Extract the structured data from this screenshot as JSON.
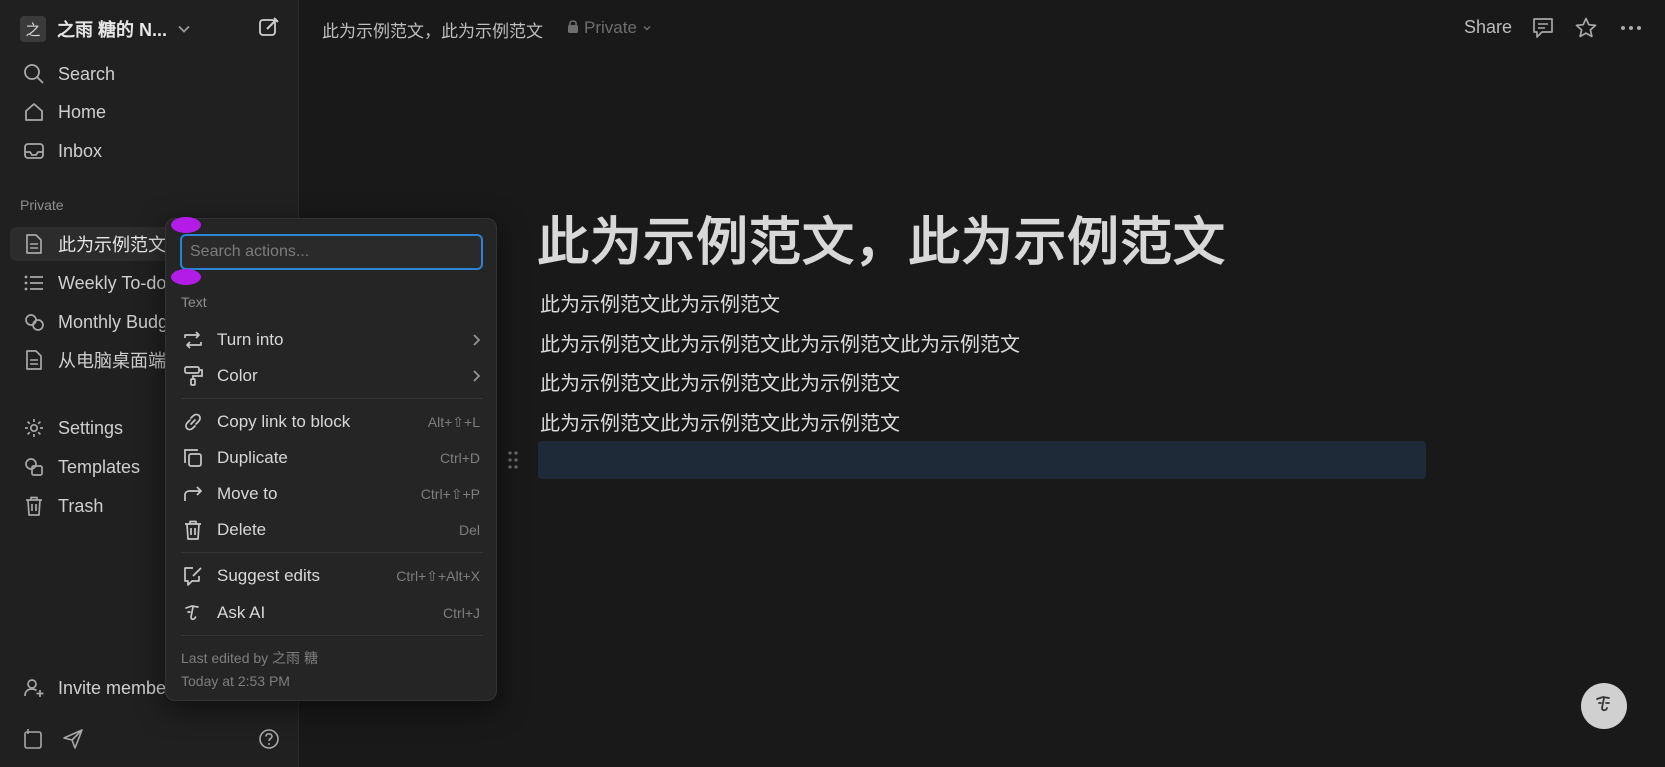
{
  "sidebar": {
    "workspace": {
      "avatar": "之",
      "name": "之雨 糖的 N..."
    },
    "nav": [
      {
        "label": "Search",
        "icon": "search-icon"
      },
      {
        "label": "Home",
        "icon": "home-icon"
      },
      {
        "label": "Inbox",
        "icon": "inbox-icon"
      }
    ],
    "section_label": "Private",
    "pages": [
      {
        "label": "此为示例范文",
        "icon": "page-icon"
      },
      {
        "label": "Weekly To-do",
        "icon": "list-icon"
      },
      {
        "label": "Monthly Budg",
        "icon": "budget-icon"
      },
      {
        "label": "从电脑桌面端",
        "icon": "page-icon"
      }
    ],
    "utility": [
      {
        "label": "Settings",
        "icon": "gear-icon"
      },
      {
        "label": "Templates",
        "icon": "templates-icon"
      },
      {
        "label": "Trash",
        "icon": "trash-icon"
      }
    ],
    "invite_label": "Invite membe"
  },
  "topbar": {
    "breadcrumb": "此为示例范文，此为示例范文",
    "privacy": "Private",
    "share": "Share"
  },
  "page": {
    "title": "此为示例范文，此为示例范文",
    "paragraphs": [
      "此为示例范文此为示例范文",
      "此为示例范文此为示例范文此为示例范文此为示例范文",
      "此为示例范文此为示例范文此为示例范文",
      "此为示例范文此为示例范文此为示例范文"
    ]
  },
  "menu": {
    "search_placeholder": "Search actions...",
    "section": "Text",
    "items": [
      {
        "label": "Turn into",
        "shortcut": "",
        "icon": "turn-into-icon"
      },
      {
        "label": "Color",
        "shortcut": "",
        "icon": "paint-roller-icon"
      },
      {
        "label": "Copy link to block",
        "shortcut": "Alt+⇧+L",
        "icon": "link-icon"
      },
      {
        "label": "Duplicate",
        "shortcut": "Ctrl+D",
        "icon": "duplicate-icon"
      },
      {
        "label": "Move to",
        "shortcut": "Ctrl+⇧+P",
        "icon": "move-to-icon"
      },
      {
        "label": "Delete",
        "shortcut": "Del",
        "icon": "trash-icon"
      },
      {
        "label": "Suggest edits",
        "shortcut": "Ctrl+⇧+Alt+X",
        "icon": "suggest-edits-icon"
      },
      {
        "label": "Ask AI",
        "shortcut": "Ctrl+J",
        "icon": "ai-icon"
      }
    ],
    "last_edited": "Last edited by 之雨 糖",
    "edited_time": "Today at 2:53 PM"
  },
  "colors": {
    "background": "#191919",
    "sidebar": "#202020",
    "accent": "#2b83d6",
    "selection_block": "#1e2a38",
    "handle": "#b31be6"
  }
}
